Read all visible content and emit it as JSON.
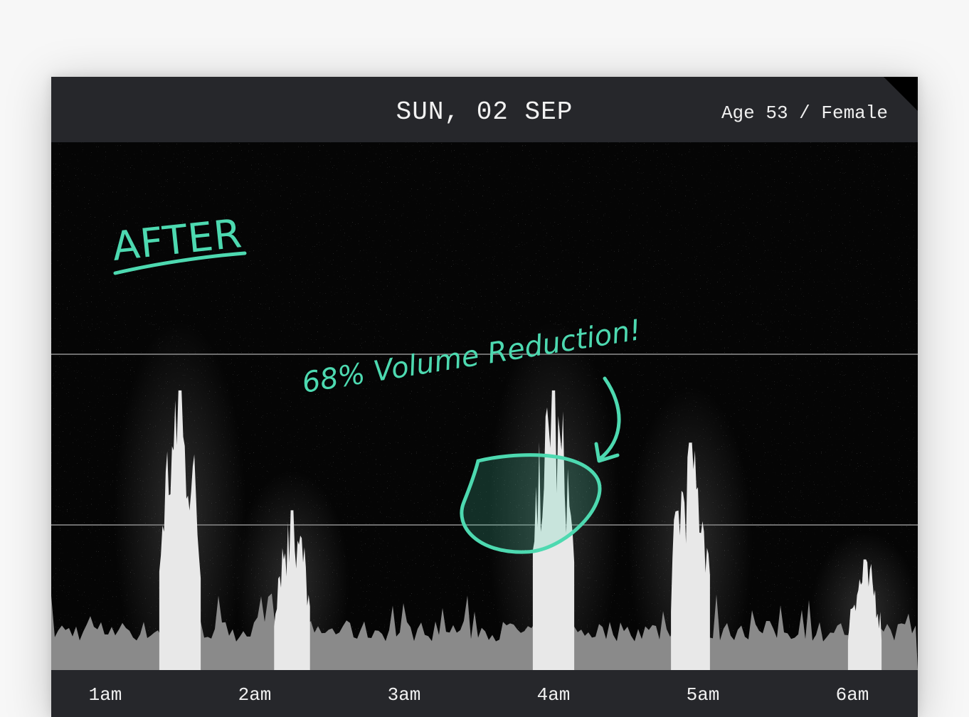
{
  "header": {
    "date": "SUN, 02 SEP",
    "profile": "Age 53 / Female"
  },
  "annotations": {
    "stage_label": "AFTER",
    "callout": "68% Volume Reduction!"
  },
  "colors": {
    "accent": "#4dd9b0",
    "header_bg": "#26272b",
    "plot_bg": "#050505",
    "baseline_fill": "#8a8a8a",
    "peak_fill": "#e8e8e8"
  },
  "chart_data": {
    "type": "area",
    "x_labels": [
      "1am",
      "2am",
      "3am",
      "4am",
      "5am",
      "6am"
    ],
    "reference_lines": 2,
    "series": [
      {
        "values_description": "",
        "peaks": [
          {
            "time": "1:30am",
            "level": 0.91
          },
          {
            "time": "2:15am",
            "level": 0.52
          },
          {
            "time": "4:00am",
            "level": 0.91
          },
          {
            "time": "4:55am",
            "level": 0.74
          },
          {
            "time": "6:05am",
            "level": 0.36
          }
        ]
      }
    ],
    "highlighted_peak": "4:00am"
  }
}
